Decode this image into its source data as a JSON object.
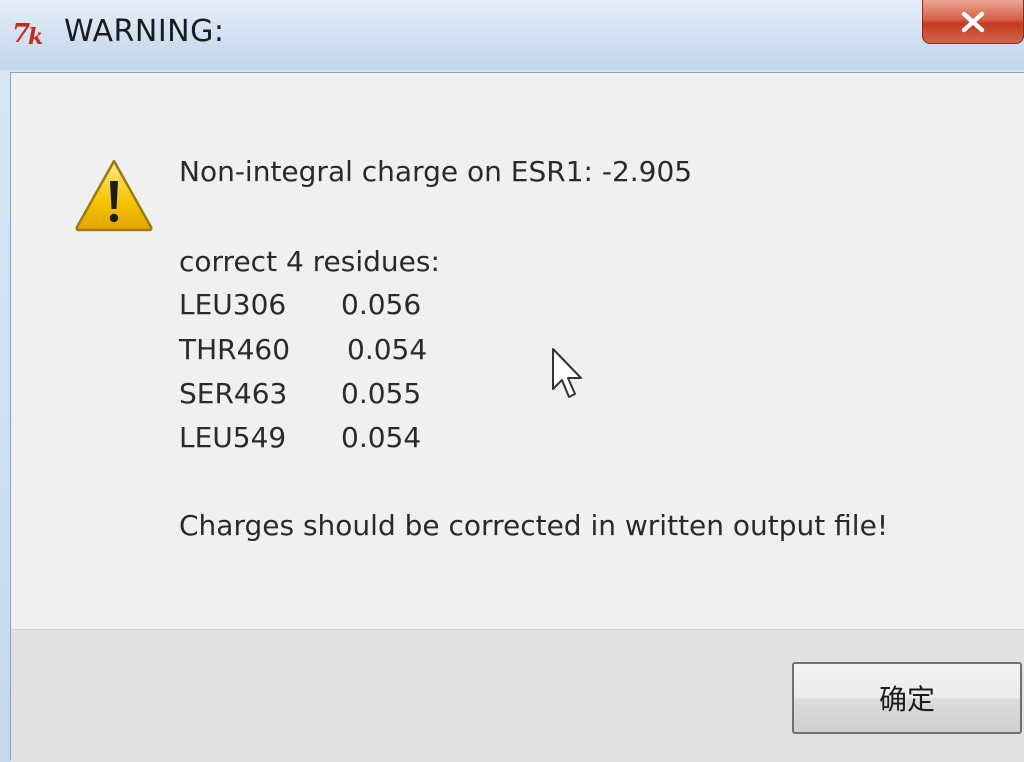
{
  "window": {
    "title": "WARNING:",
    "app_icon": "tk-feather-icon",
    "close_icon": "close-icon"
  },
  "message": {
    "icon": "warning-icon",
    "headline": "Non-integral charge on ESR1: -2.905",
    "subheading": "correct 4 residues:",
    "residues": [
      {
        "name": "LEU306",
        "value": "0.056"
      },
      {
        "name": "THR460",
        "value": "0.054"
      },
      {
        "name": "SER463",
        "value": "0.055"
      },
      {
        "name": "LEU549",
        "value": "0.054"
      }
    ],
    "footer": "Charges should be corrected in written output file!"
  },
  "buttons": {
    "ok_label": "确定"
  },
  "colors": {
    "titlebar": "#cfdff1",
    "close_button": "#c23a22",
    "dialog_bg": "#f0f0f0",
    "button_area": "#e2e2e2"
  }
}
